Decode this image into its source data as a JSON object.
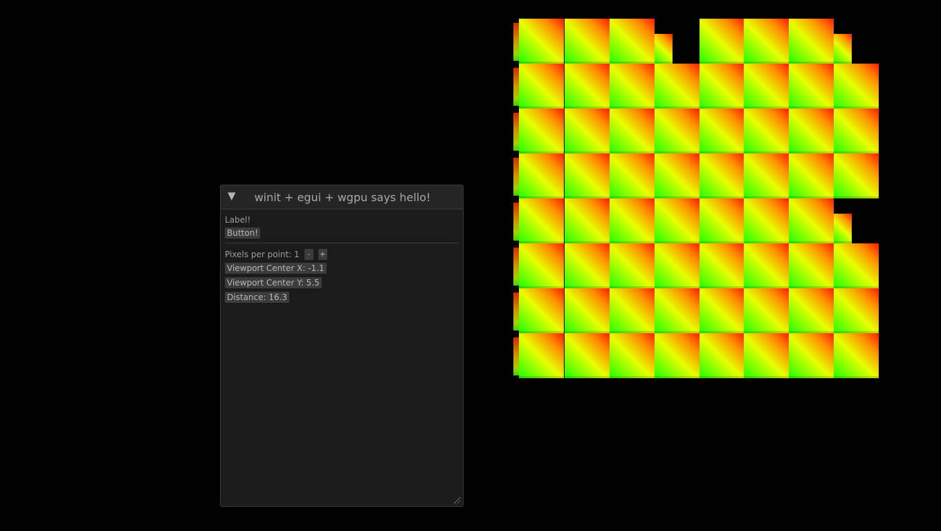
{
  "window": {
    "title": "winit + egui + wgpu says hello!",
    "collapse_icon": "triangle-down-icon",
    "label": "Label!",
    "button_label": "Button!",
    "pixels_per_point_label": "Pixels per point: 1",
    "minus_label": "-",
    "plus_label": "+",
    "viewport_center_x": "Viewport Center X: -1.1",
    "viewport_center_y": "Viewport Center Y: 5.5",
    "distance": "Distance: 16.3"
  },
  "scene": {
    "description_colors": {
      "green": "#1dff00",
      "yellow": "#e8ff00",
      "orange": "#ff8a00",
      "red": "#ff1a00"
    }
  }
}
